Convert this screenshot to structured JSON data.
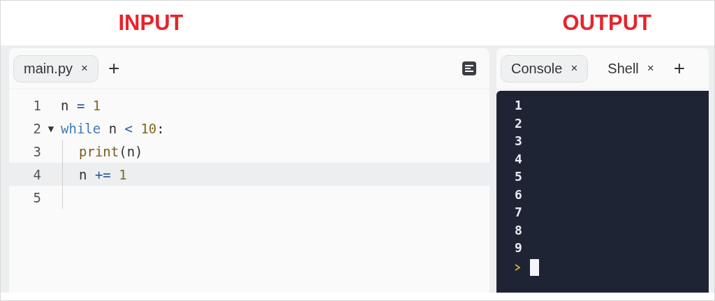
{
  "input_panel": {
    "heading": "INPUT",
    "tabs": [
      {
        "label": "main.py",
        "close": "×",
        "selected": true
      }
    ],
    "add_tab": "+",
    "editor": {
      "lines": [
        {
          "number": "1",
          "indented": false,
          "active": false,
          "tokens": [
            {
              "kind": "name",
              "text": "n"
            },
            {
              "kind": "op",
              "text": " = "
            },
            {
              "kind": "num",
              "text": "1"
            }
          ]
        },
        {
          "number": "2",
          "fold": "▼",
          "indented": false,
          "active": false,
          "tokens": [
            {
              "kind": "kw",
              "text": "while"
            },
            {
              "kind": "name",
              "text": " n "
            },
            {
              "kind": "op",
              "text": "<"
            },
            {
              "kind": "num",
              "text": " 10"
            },
            {
              "kind": "name",
              "text": ":"
            }
          ]
        },
        {
          "number": "3",
          "indented": true,
          "active": false,
          "tokens": [
            {
              "kind": "fn",
              "text": "print"
            },
            {
              "kind": "name",
              "text": "(n)"
            }
          ]
        },
        {
          "number": "4",
          "indented": true,
          "active": true,
          "tokens": [
            {
              "kind": "name",
              "text": "n "
            },
            {
              "kind": "op",
              "text": "+="
            },
            {
              "kind": "num",
              "text": " 1"
            }
          ]
        },
        {
          "number": "5",
          "indented": true,
          "active": false
        }
      ]
    }
  },
  "output_panel": {
    "heading": "OUTPUT",
    "tabs": [
      {
        "label": "Console",
        "close": "×",
        "selected": true
      },
      {
        "label": "Shell",
        "close": "×",
        "selected": false
      }
    ],
    "add_tab": "+",
    "console": {
      "lines": [
        "1",
        "2",
        "3",
        "4",
        "5",
        "6",
        "7",
        "8",
        "9"
      ]
    }
  }
}
